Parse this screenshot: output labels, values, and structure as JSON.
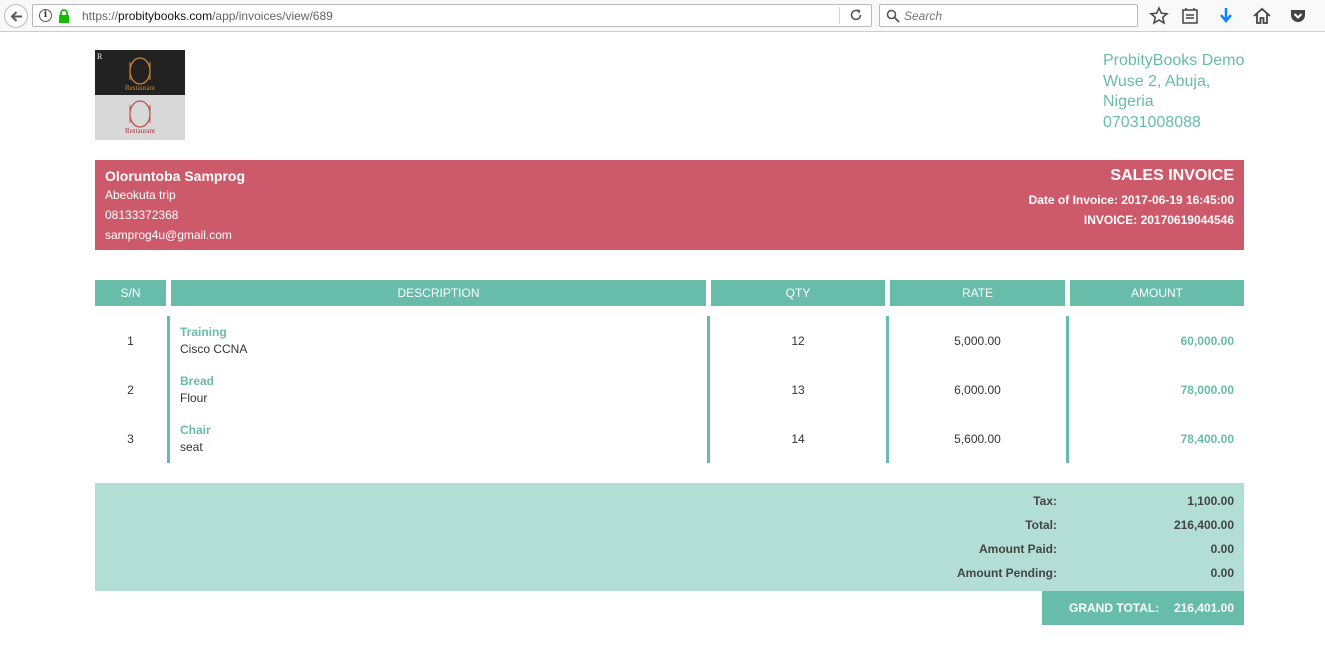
{
  "browser": {
    "url_prefix": "https://",
    "url_host": "probitybooks.com",
    "url_path": "/app/invoices/view/689",
    "search_placeholder": "Search",
    "info_glyph": "i"
  },
  "logo": {
    "text": "Restaurant"
  },
  "company": {
    "name": "ProbityBooks Demo",
    "address1": "Wuse 2, Abuja,",
    "address2": "Nigeria",
    "phone": "07031008088"
  },
  "client": {
    "name": "Oloruntoba Samprog",
    "address": "Abeokuta trip",
    "phone": "08133372368",
    "email": "samprog4u@gmail.com"
  },
  "invoice": {
    "title": "SALES INVOICE",
    "date_line": "Date of Invoice: 2017-06-19 16:45:00",
    "number_line": "INVOICE: 20170619044546"
  },
  "table": {
    "headers": [
      "S/N",
      "DESCRIPTION",
      "QTY",
      "RATE",
      "AMOUNT"
    ],
    "rows": [
      {
        "sn": "1",
        "title": "Training",
        "desc": "Cisco CCNA",
        "qty": "12",
        "rate": "5,000.00",
        "amount": "60,000.00"
      },
      {
        "sn": "2",
        "title": "Bread",
        "desc": "Flour",
        "qty": "13",
        "rate": "6,000.00",
        "amount": "78,000.00"
      },
      {
        "sn": "3",
        "title": "Chair",
        "desc": "seat",
        "qty": "14",
        "rate": "5,600.00",
        "amount": "78,400.00"
      }
    ]
  },
  "totals": {
    "tax_label": "Tax:",
    "tax": "1,100.00",
    "total_label": "Total:",
    "total": "216,400.00",
    "paid_label": "Amount Paid:",
    "paid": "0.00",
    "pending_label": "Amount Pending:",
    "pending": "0.00",
    "grand_label": "GRAND TOTAL:",
    "grand": "216,401.00"
  }
}
